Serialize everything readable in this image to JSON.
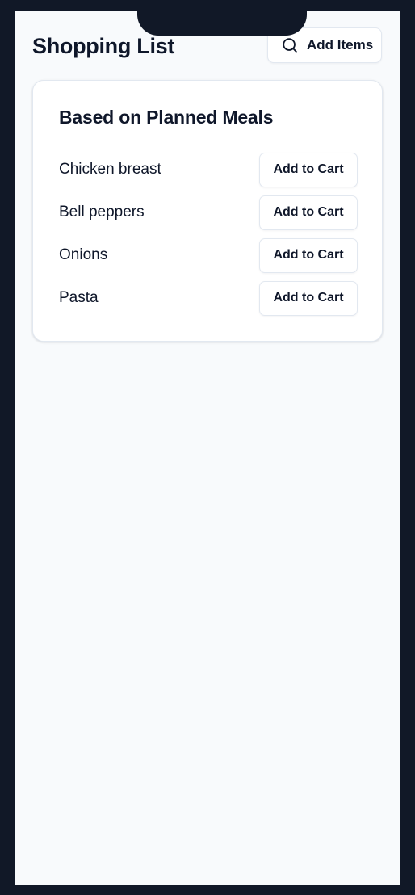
{
  "header": {
    "title": "Shopping List",
    "add_items_label": "Add Items",
    "add_items_icon": "search-icon"
  },
  "card": {
    "title": "Based on Planned Meals",
    "items": [
      {
        "name": "Chicken breast",
        "button_label": "Add to Cart"
      },
      {
        "name": "Bell peppers",
        "button_label": "Add to Cart"
      },
      {
        "name": "Onions",
        "button_label": "Add to Cart"
      },
      {
        "name": "Pasta",
        "button_label": "Add to Cart"
      }
    ]
  },
  "colors": {
    "frame": "#111827",
    "screen_background": "#f8fafc",
    "card_background": "#ffffff",
    "border": "#e2e8f0",
    "text": "#0f172a"
  }
}
